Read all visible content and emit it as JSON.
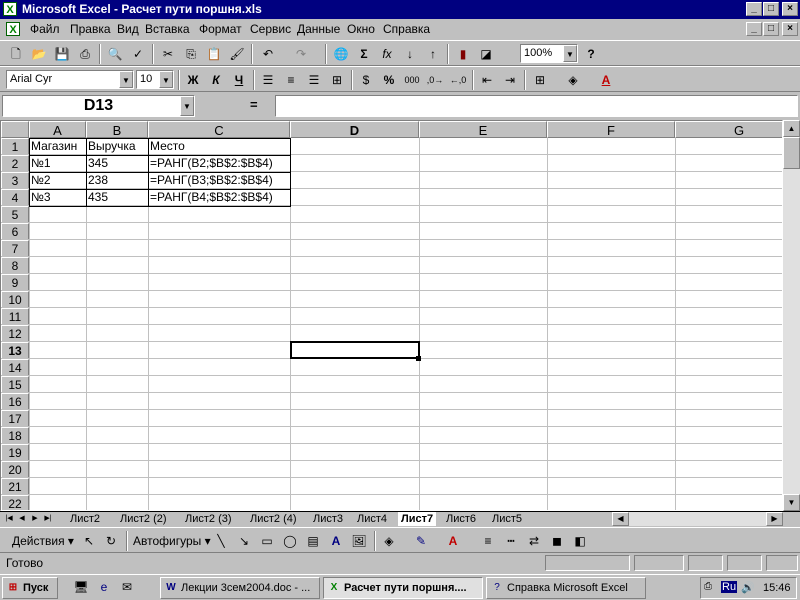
{
  "window": {
    "title": "Microsoft Excel - Расчет пути поршня.xls",
    "min_label": "_",
    "max_label": "□",
    "close_label": "×"
  },
  "menu": [
    "Файл",
    "Правка",
    "Вид",
    "Вставка",
    "Формат",
    "Сервис",
    "Данные",
    "Окно",
    "Справка"
  ],
  "toolbar": {
    "zoom": "100%",
    "font_name": "Arial Cyr",
    "font_size": "10",
    "bold_label": "Ж",
    "italic_label": "К",
    "underline_label": "Ч",
    "percent_label": "%",
    "thousands_label": "000",
    "sum_label": "Σ",
    "fx_label": "fx"
  },
  "formula_bar": {
    "name_box": "D13",
    "equals": "=",
    "value": ""
  },
  "sheet": {
    "columns": [
      "A",
      "B",
      "C",
      "D",
      "E",
      "F",
      "G"
    ],
    "rows": [
      "1",
      "2",
      "3",
      "4",
      "5",
      "6",
      "7",
      "8",
      "9",
      "10",
      "11",
      "12",
      "13",
      "14",
      "15",
      "16",
      "17",
      "18",
      "19",
      "20",
      "21",
      "22"
    ],
    "active_cell": "D13",
    "cells": [
      [
        "Магазин",
        "Выручка",
        "Место"
      ],
      [
        "№1",
        "345",
        "=РАНГ(B2;$B$2:$B$4)"
      ],
      [
        "№2",
        "238",
        "=РАНГ(B3;$B$2:$B$4)"
      ],
      [
        "№3",
        "435",
        "=РАНГ(B4;$B$2:$B$4)"
      ]
    ]
  },
  "tabs": [
    "Лист2",
    "Лист2 (2)",
    "Лист2 (3)",
    "Лист2 (4)",
    "Лист3",
    "Лист4",
    "Лист7",
    "Лист6",
    "Лист5"
  ],
  "active_tab": "Лист7",
  "drawing": {
    "actions_label": "Действия",
    "autoshapes_label": "Автофигуры"
  },
  "status": {
    "text": "Готово"
  },
  "taskbar": {
    "start_label": "Пуск",
    "items": [
      "Лекции 3сем2004.doc - ...",
      "Расчет пути поршня....",
      "Справка Microsoft Excel"
    ],
    "lang": "Ru",
    "clock": "15:46"
  }
}
